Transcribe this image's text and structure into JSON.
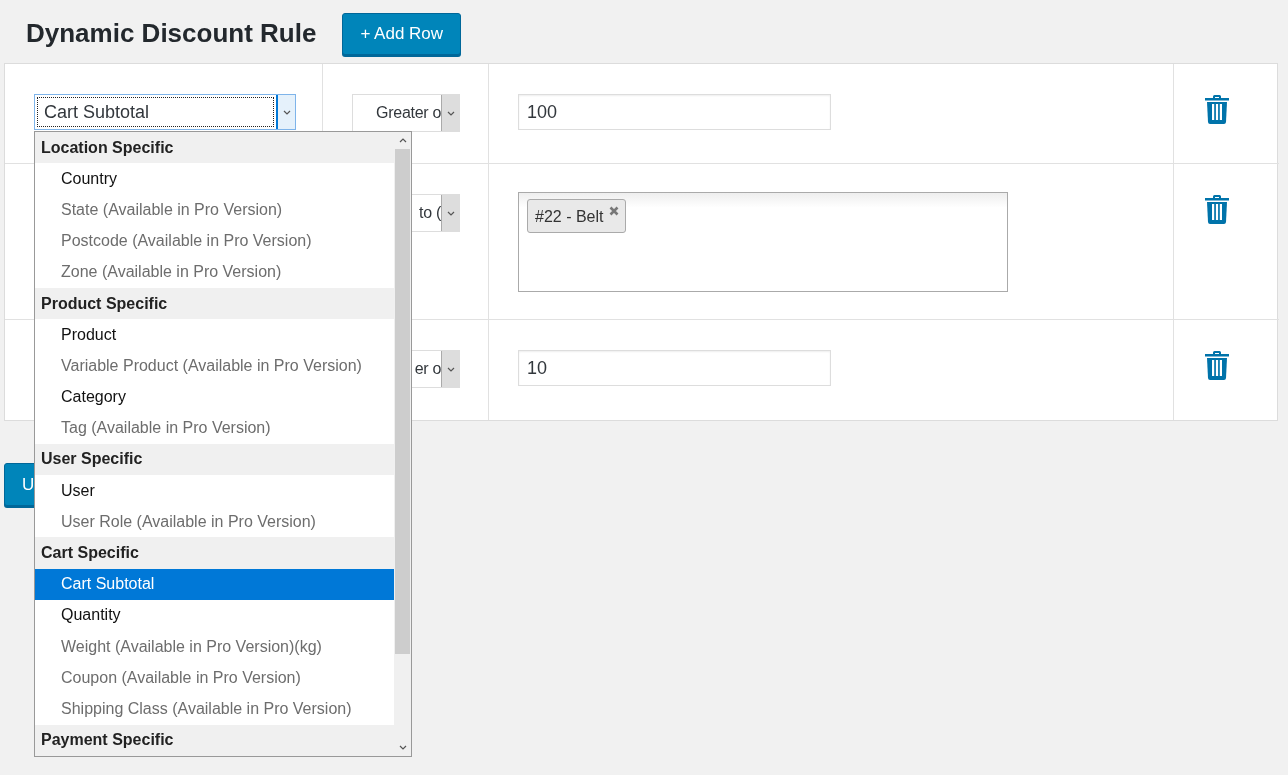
{
  "title": "Dynamic Discount Rule",
  "add_button": "+ Add Row",
  "rules": [
    {
      "condition": "Cart Subtotal",
      "operator": "Greater o",
      "value": {
        "kind": "text",
        "text": "100"
      }
    },
    {
      "operator": "to (",
      "value": {
        "kind": "tags",
        "tags": [
          "#22 - Belt"
        ]
      }
    },
    {
      "operator": "er o",
      "value": {
        "kind": "text",
        "text": "10"
      }
    }
  ],
  "footer_button": "U",
  "dropdown": {
    "groups": [
      {
        "label": "Location Specific",
        "options": [
          {
            "label": "Country",
            "disabled": false,
            "selected": false
          },
          {
            "label": "State (Available in Pro Version)",
            "disabled": true,
            "selected": false
          },
          {
            "label": "Postcode (Available in Pro Version)",
            "disabled": true,
            "selected": false
          },
          {
            "label": "Zone (Available in Pro Version)",
            "disabled": true,
            "selected": false
          }
        ]
      },
      {
        "label": "Product Specific",
        "options": [
          {
            "label": "Product",
            "disabled": false,
            "selected": false
          },
          {
            "label": "Variable Product (Available in Pro Version)",
            "disabled": true,
            "selected": false
          },
          {
            "label": "Category",
            "disabled": false,
            "selected": false
          },
          {
            "label": "Tag (Available in Pro Version)",
            "disabled": true,
            "selected": false
          }
        ]
      },
      {
        "label": "User Specific",
        "options": [
          {
            "label": "User",
            "disabled": false,
            "selected": false
          },
          {
            "label": "User Role (Available in Pro Version)",
            "disabled": true,
            "selected": false
          }
        ]
      },
      {
        "label": "Cart Specific",
        "options": [
          {
            "label": "Cart Subtotal",
            "disabled": false,
            "selected": true
          },
          {
            "label": "Quantity",
            "disabled": false,
            "selected": false
          },
          {
            "label": "Weight (Available in Pro Version)(kg)",
            "disabled": true,
            "selected": false
          },
          {
            "label": "Coupon (Available in Pro Version)",
            "disabled": true,
            "selected": false
          },
          {
            "label": "Shipping Class (Available in Pro Version)",
            "disabled": true,
            "selected": false
          }
        ]
      },
      {
        "label": "Payment Specific"
      }
    ]
  }
}
